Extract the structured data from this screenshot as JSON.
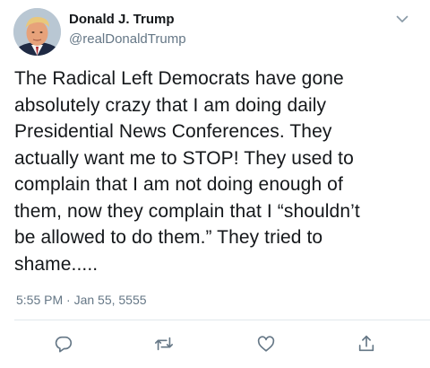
{
  "tweet": {
    "author": {
      "display_name": "Donald J. Trump",
      "handle": "@realDonaldTrump",
      "avatar_icon": "profile-photo"
    },
    "text_lines": [
      "The Radical Left Democrats have gone",
      "absolutely crazy that I am doing daily",
      "Presidential News Conferences. They",
      "actually want me to STOP! They used to",
      "complain that I am not doing enough of",
      "them, now they complain that I “shouldn’t",
      "be allowed to do them.” They tried to",
      "shame....."
    ],
    "timestamp": "5:55 PM · Jan 55, 5555"
  },
  "actions": {
    "reply_icon": "reply-icon",
    "retweet_icon": "retweet-icon",
    "like_icon": "like-icon",
    "share_icon": "share-icon"
  },
  "colors": {
    "text": "#14171a",
    "secondary": "#657786",
    "divider": "#e1e8ed"
  }
}
